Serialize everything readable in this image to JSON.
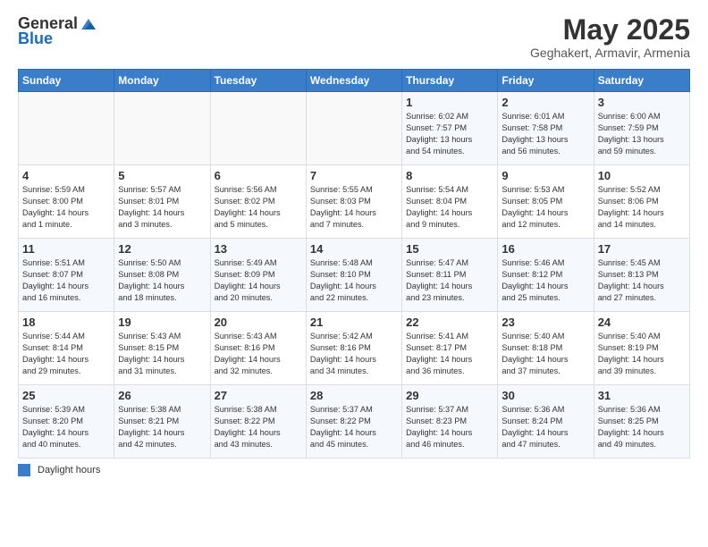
{
  "header": {
    "logo_general": "General",
    "logo_blue": "Blue",
    "month_title": "May 2025",
    "location": "Geghakert, Armavir, Armenia"
  },
  "days_of_week": [
    "Sunday",
    "Monday",
    "Tuesday",
    "Wednesday",
    "Thursday",
    "Friday",
    "Saturday"
  ],
  "weeks": [
    [
      {
        "day": "",
        "info": ""
      },
      {
        "day": "",
        "info": ""
      },
      {
        "day": "",
        "info": ""
      },
      {
        "day": "",
        "info": ""
      },
      {
        "day": "1",
        "info": "Sunrise: 6:02 AM\nSunset: 7:57 PM\nDaylight: 13 hours\nand 54 minutes."
      },
      {
        "day": "2",
        "info": "Sunrise: 6:01 AM\nSunset: 7:58 PM\nDaylight: 13 hours\nand 56 minutes."
      },
      {
        "day": "3",
        "info": "Sunrise: 6:00 AM\nSunset: 7:59 PM\nDaylight: 13 hours\nand 59 minutes."
      }
    ],
    [
      {
        "day": "4",
        "info": "Sunrise: 5:59 AM\nSunset: 8:00 PM\nDaylight: 14 hours\nand 1 minute."
      },
      {
        "day": "5",
        "info": "Sunrise: 5:57 AM\nSunset: 8:01 PM\nDaylight: 14 hours\nand 3 minutes."
      },
      {
        "day": "6",
        "info": "Sunrise: 5:56 AM\nSunset: 8:02 PM\nDaylight: 14 hours\nand 5 minutes."
      },
      {
        "day": "7",
        "info": "Sunrise: 5:55 AM\nSunset: 8:03 PM\nDaylight: 14 hours\nand 7 minutes."
      },
      {
        "day": "8",
        "info": "Sunrise: 5:54 AM\nSunset: 8:04 PM\nDaylight: 14 hours\nand 9 minutes."
      },
      {
        "day": "9",
        "info": "Sunrise: 5:53 AM\nSunset: 8:05 PM\nDaylight: 14 hours\nand 12 minutes."
      },
      {
        "day": "10",
        "info": "Sunrise: 5:52 AM\nSunset: 8:06 PM\nDaylight: 14 hours\nand 14 minutes."
      }
    ],
    [
      {
        "day": "11",
        "info": "Sunrise: 5:51 AM\nSunset: 8:07 PM\nDaylight: 14 hours\nand 16 minutes."
      },
      {
        "day": "12",
        "info": "Sunrise: 5:50 AM\nSunset: 8:08 PM\nDaylight: 14 hours\nand 18 minutes."
      },
      {
        "day": "13",
        "info": "Sunrise: 5:49 AM\nSunset: 8:09 PM\nDaylight: 14 hours\nand 20 minutes."
      },
      {
        "day": "14",
        "info": "Sunrise: 5:48 AM\nSunset: 8:10 PM\nDaylight: 14 hours\nand 22 minutes."
      },
      {
        "day": "15",
        "info": "Sunrise: 5:47 AM\nSunset: 8:11 PM\nDaylight: 14 hours\nand 23 minutes."
      },
      {
        "day": "16",
        "info": "Sunrise: 5:46 AM\nSunset: 8:12 PM\nDaylight: 14 hours\nand 25 minutes."
      },
      {
        "day": "17",
        "info": "Sunrise: 5:45 AM\nSunset: 8:13 PM\nDaylight: 14 hours\nand 27 minutes."
      }
    ],
    [
      {
        "day": "18",
        "info": "Sunrise: 5:44 AM\nSunset: 8:14 PM\nDaylight: 14 hours\nand 29 minutes."
      },
      {
        "day": "19",
        "info": "Sunrise: 5:43 AM\nSunset: 8:15 PM\nDaylight: 14 hours\nand 31 minutes."
      },
      {
        "day": "20",
        "info": "Sunrise: 5:43 AM\nSunset: 8:16 PM\nDaylight: 14 hours\nand 32 minutes."
      },
      {
        "day": "21",
        "info": "Sunrise: 5:42 AM\nSunset: 8:16 PM\nDaylight: 14 hours\nand 34 minutes."
      },
      {
        "day": "22",
        "info": "Sunrise: 5:41 AM\nSunset: 8:17 PM\nDaylight: 14 hours\nand 36 minutes."
      },
      {
        "day": "23",
        "info": "Sunrise: 5:40 AM\nSunset: 8:18 PM\nDaylight: 14 hours\nand 37 minutes."
      },
      {
        "day": "24",
        "info": "Sunrise: 5:40 AM\nSunset: 8:19 PM\nDaylight: 14 hours\nand 39 minutes."
      }
    ],
    [
      {
        "day": "25",
        "info": "Sunrise: 5:39 AM\nSunset: 8:20 PM\nDaylight: 14 hours\nand 40 minutes."
      },
      {
        "day": "26",
        "info": "Sunrise: 5:38 AM\nSunset: 8:21 PM\nDaylight: 14 hours\nand 42 minutes."
      },
      {
        "day": "27",
        "info": "Sunrise: 5:38 AM\nSunset: 8:22 PM\nDaylight: 14 hours\nand 43 minutes."
      },
      {
        "day": "28",
        "info": "Sunrise: 5:37 AM\nSunset: 8:22 PM\nDaylight: 14 hours\nand 45 minutes."
      },
      {
        "day": "29",
        "info": "Sunrise: 5:37 AM\nSunset: 8:23 PM\nDaylight: 14 hours\nand 46 minutes."
      },
      {
        "day": "30",
        "info": "Sunrise: 5:36 AM\nSunset: 8:24 PM\nDaylight: 14 hours\nand 47 minutes."
      },
      {
        "day": "31",
        "info": "Sunrise: 5:36 AM\nSunset: 8:25 PM\nDaylight: 14 hours\nand 49 minutes."
      }
    ]
  ],
  "footer": {
    "daylight_label": "Daylight hours"
  }
}
